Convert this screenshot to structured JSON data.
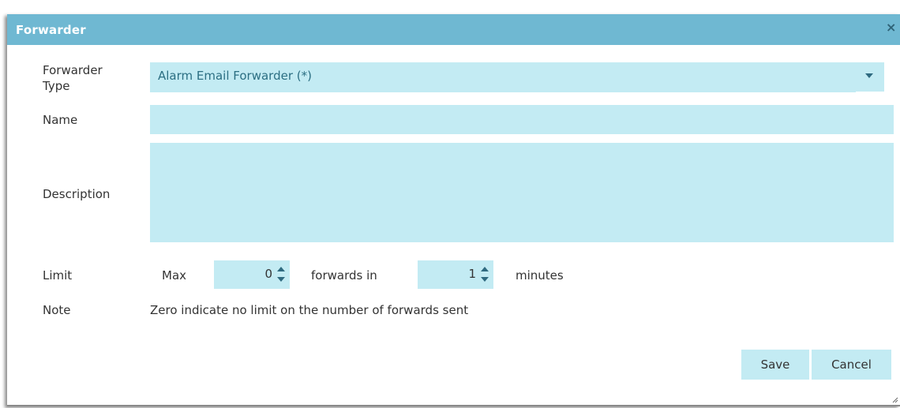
{
  "dialog": {
    "title": "Forwarder",
    "close_icon": "×"
  },
  "form": {
    "forwarder_type": {
      "label_line1": "Forwarder",
      "label_line2": "Type",
      "value": "Alarm Email Forwarder (*)",
      "icon": "caret-down-icon"
    },
    "name": {
      "label": "Name",
      "value": ""
    },
    "description": {
      "label": "Description",
      "value": ""
    },
    "limit": {
      "label": "Limit",
      "max_label": "Max",
      "max_value": "0",
      "forwards_in_label": "forwards in",
      "minutes_value": "1",
      "minutes_label": "minutes"
    },
    "note": {
      "label": "Note",
      "text": "Zero indicate no limit on the number of forwards sent"
    }
  },
  "buttons": {
    "save": "Save",
    "cancel": "Cancel"
  },
  "colors": {
    "titlebar": "#6fb8d2",
    "field_bg": "#c3ebf3",
    "accent_text": "#2c6f83"
  }
}
